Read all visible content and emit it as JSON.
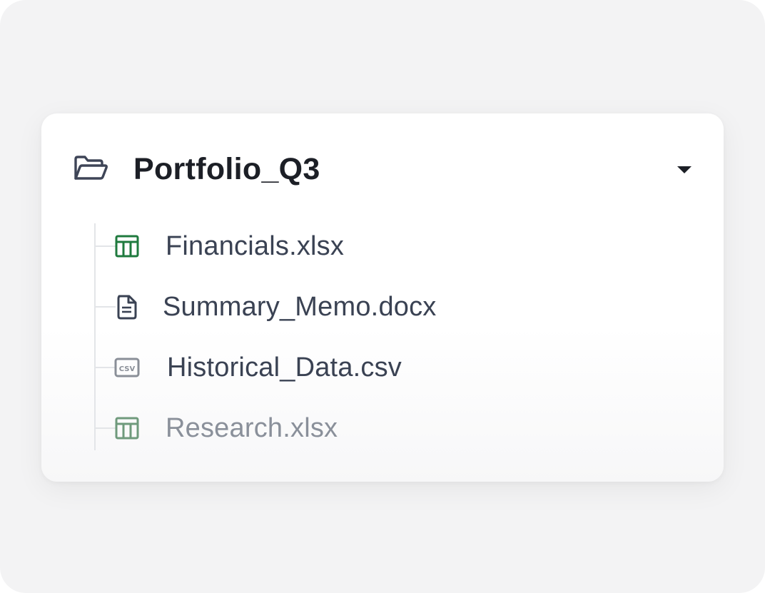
{
  "folder": {
    "name": "Portfolio_Q3",
    "icon": "folder-open-icon",
    "expanded": true,
    "toggle_icon": "caret-down-icon"
  },
  "files": [
    {
      "name": "Financials.xlsx",
      "icon": "spreadsheet-icon",
      "icon_color": "#1f7a3e",
      "faded": false
    },
    {
      "name": "Summary_Memo.docx",
      "icon": "document-icon",
      "icon_color": "#3a4253",
      "faded": false
    },
    {
      "name": "Historical_Data.csv",
      "icon": "csv-icon",
      "icon_label": "CSV",
      "icon_color": "#8a8f98",
      "faded": false
    },
    {
      "name": "Research.xlsx",
      "icon": "spreadsheet-icon",
      "icon_color": "#6f9a7c",
      "faded": true
    }
  ],
  "colors": {
    "background": "#f3f3f4",
    "card": "#ffffff",
    "title_text": "#1c1f26",
    "file_text": "#3a4253",
    "faded_text": "#8a909a",
    "tree_line": "#e3e5e8"
  }
}
